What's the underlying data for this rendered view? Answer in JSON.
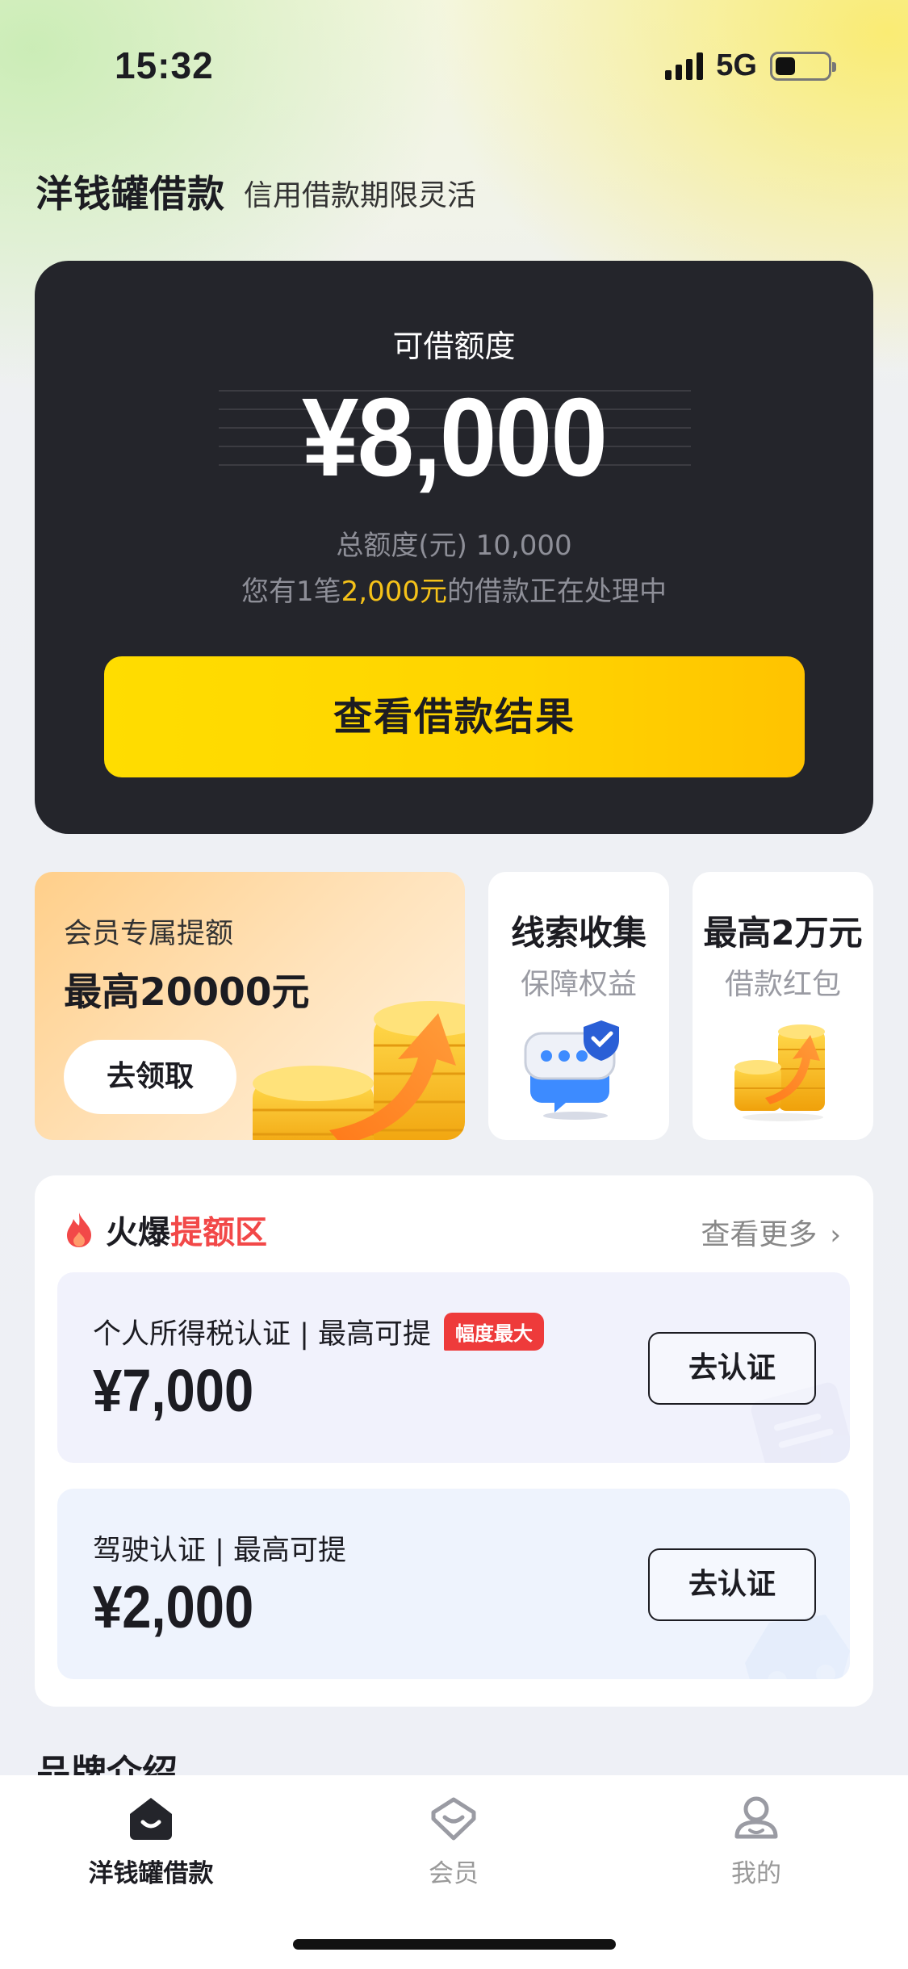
{
  "status_bar": {
    "time": "15:32",
    "network": "5G"
  },
  "header": {
    "title": "洋钱罐借款",
    "subtitle": "信用借款期限灵活"
  },
  "credit": {
    "label": "可借额度",
    "amount": "¥8,000",
    "total_line": "总额度(元) 10,000",
    "note_prefix": "您有1笔",
    "note_highlight": "2,000元",
    "note_suffix": "的借款正在处理中",
    "button": "查看借款结果"
  },
  "promos": {
    "member": {
      "title": "会员专属提额",
      "headline": "最高20000元",
      "button": "去领取"
    },
    "clue": {
      "title": "线索收集",
      "subtitle": "保障权益"
    },
    "max": {
      "title": "最高2万元",
      "subtitle": "借款红包"
    }
  },
  "hot_zone": {
    "title_prefix": "火爆",
    "title_highlight": "提额区",
    "more": "查看更多",
    "items": [
      {
        "label": "个人所得税认证 | 最高可提",
        "badge": "幅度最大",
        "amount": "¥7,000",
        "button": "去认证"
      },
      {
        "label": "驾驶认证 | 最高可提",
        "amount": "¥2,000",
        "button": "去认证"
      }
    ]
  },
  "section_peek": "品牌介绍",
  "tabbar": {
    "tabs": [
      {
        "label": "洋钱罐借款"
      },
      {
        "label": "会员"
      },
      {
        "label": "我的"
      }
    ]
  },
  "colors": {
    "accent_yellow": "#FFD400",
    "card_dark": "#24252B",
    "hot_red": "#F24848",
    "highlight_gold": "#F5C219"
  }
}
